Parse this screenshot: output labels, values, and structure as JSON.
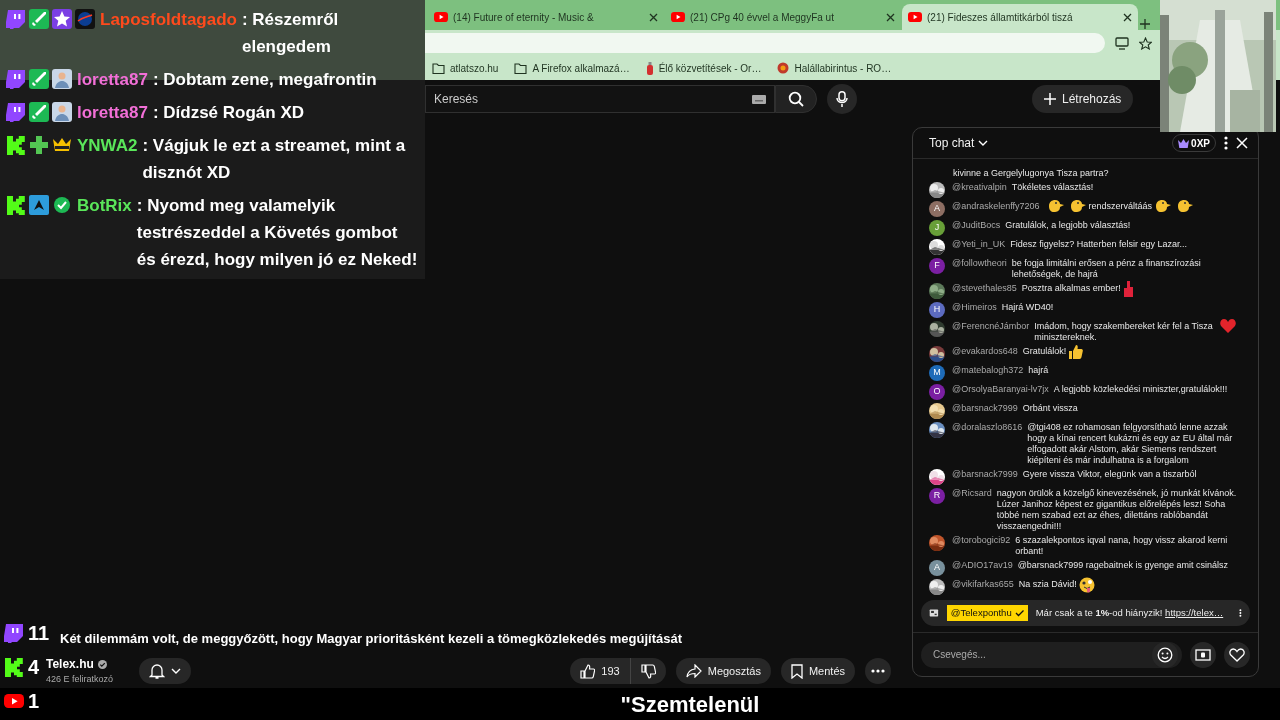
{
  "browser": {
    "tabs": [
      {
        "title": "(14) Future of eternity - Music &",
        "selected": false
      },
      {
        "title": "(21) CPg 40 évvel a MeggyFa ut",
        "selected": false
      },
      {
        "title": "(21) Fideszes államtitkárból tiszá",
        "selected": true
      }
    ],
    "bookmarks": [
      {
        "label": "atlatszo.hu",
        "kind": "folder"
      },
      {
        "label": "A Firefox alkalmazá…",
        "kind": "folder"
      },
      {
        "label": "Élő közvetítések - Or…",
        "kind": "flask"
      },
      {
        "label": "Halállabirintus - RO…",
        "kind": "round"
      }
    ]
  },
  "youtube": {
    "search": {
      "placeholder": "Keresés"
    },
    "create": "Létrehozás",
    "video": {
      "title": "Két dilemmám volt, de meggyőzött, hogy Magyar prioritásként kezeli a tömegközlekedés megújítását",
      "channel": {
        "name": "Telex.hu",
        "verified": true,
        "subscribers": "426 E feliratkozó"
      },
      "likes": "193",
      "share": "Megosztás",
      "save": "Mentés"
    },
    "chat": {
      "title": "Top chat",
      "xp": "0XP",
      "messages": [
        {
          "avatar": {
            "kind": "none"
          },
          "segments": [
            {
              "kind": "text",
              "text": "kivinne a Gergelylugonya Tisza partra?"
            }
          ]
        },
        {
          "avatar": {
            "kind": "picture"
          },
          "author": "@kreativalpin",
          "segments": [
            {
              "kind": "text",
              "text": "Tökéletes választás!"
            }
          ]
        },
        {
          "avatar": {
            "kind": "letter",
            "letter": "A",
            "color": "#8d6e63"
          },
          "author": "@andraskelenffy7206",
          "segments": [
            {
              "kind": "bird"
            },
            {
              "kind": "bird"
            },
            {
              "kind": "text",
              "text": "rendszerváltáás"
            },
            {
              "kind": "bird"
            },
            {
              "kind": "bird"
            }
          ]
        },
        {
          "avatar": {
            "kind": "letter",
            "letter": "J",
            "color": "#689f38"
          },
          "author": "@JuditBocs",
          "segments": [
            {
              "kind": "text",
              "text": "Gratulálok, a legjobb választás!"
            }
          ]
        },
        {
          "avatar": {
            "kind": "picture"
          },
          "author": "@Yeti_in_UK",
          "segments": [
            {
              "kind": "text",
              "text": "Fidesz figyelsz? Hatterben felsir egy Lazar..."
            }
          ]
        },
        {
          "avatar": {
            "kind": "letter",
            "letter": "F",
            "color": "#7b1fa2"
          },
          "author": "@followtheori",
          "segments": [
            {
              "kind": "text",
              "text": "be fogja limitálni erősen a pénz a finanszírozási lehetőségek, de hajrá"
            }
          ]
        },
        {
          "avatar": {
            "kind": "picture"
          },
          "author": "@stevethales85",
          "segments": [
            {
              "kind": "text",
              "text": "Posztra alkalmas ember!"
            },
            {
              "kind": "finger"
            }
          ]
        },
        {
          "avatar": {
            "kind": "letter",
            "letter": "H",
            "color": "#5c6bc0"
          },
          "author": "@Himeiros",
          "segments": [
            {
              "kind": "text",
              "text": "Hajrá WD40!"
            }
          ]
        },
        {
          "avatar": {
            "kind": "picture"
          },
          "author": "@FerencnéJámbor",
          "segments": [
            {
              "kind": "text",
              "text": "Imádom, hogy szakembereket kér fel a Tisza minisztereknek."
            },
            {
              "kind": "heart"
            }
          ]
        },
        {
          "avatar": {
            "kind": "picture"
          },
          "author": "@evakardos648",
          "segments": [
            {
              "kind": "text",
              "text": "Gratulálok!"
            },
            {
              "kind": "thumbs"
            }
          ]
        },
        {
          "avatar": {
            "kind": "letter",
            "letter": "M",
            "color": "#1e6bb8"
          },
          "author": "@matebalogh372",
          "segments": [
            {
              "kind": "text",
              "text": "hajrá"
            }
          ]
        },
        {
          "avatar": {
            "kind": "letter",
            "letter": "O",
            "color": "#7b1fa2"
          },
          "author": "@OrsolyaBaranyai-lv7jx",
          "segments": [
            {
              "kind": "text",
              "text": "A legjobb közlekedési miniszter,gratulálok!!!"
            }
          ]
        },
        {
          "avatar": {
            "kind": "picture"
          },
          "author": "@barsnack7999",
          "segments": [
            {
              "kind": "text",
              "text": "Orbánt vissza"
            }
          ]
        },
        {
          "avatar": {
            "kind": "picture"
          },
          "author": "@doralaszlo8616",
          "segments": [
            {
              "kind": "text",
              "text": "@tgi408 ez rohamosan felgyorsítható lenne azzak hogy a kínai rencert kukázni és egy az EU által már elfogadott akár Alstom, akár Siemens rendszert kiépíteni és már indulhatna is a forgalom"
            }
          ]
        },
        {
          "avatar": {
            "kind": "picture"
          },
          "author": "@barsnack7999",
          "segments": [
            {
              "kind": "text",
              "text": "Gyere vissza Viktor, elegünk van a tiszarból"
            }
          ]
        },
        {
          "avatar": {
            "kind": "letter",
            "letter": "R",
            "color": "#7b1fa2"
          },
          "author": "@Ricsard",
          "segments": [
            {
              "kind": "text",
              "text": "nagyon örülök a közelgő kinevezésének, jó munkát kívánok. Lúzer Janihoz képest ez gigantikus előrelépés lesz! Soha többé nem szabad ezt az éhes, dilettáns rablóbandát visszaengedni!!!"
            }
          ]
        },
        {
          "avatar": {
            "kind": "picture"
          },
          "author": "@torobogici92",
          "segments": [
            {
              "kind": "text",
              "text": "6 szazalekpontos iqval nana, hogy vissz akarod kerni orbant!"
            }
          ]
        },
        {
          "avatar": {
            "kind": "letter",
            "letter": "A",
            "color": "#78909c"
          },
          "author": "@ADIO17av19",
          "segments": [
            {
              "kind": "text",
              "text": "@barsnack7999 ragebaitnek is gyenge amit csinálsz"
            }
          ]
        },
        {
          "avatar": {
            "kind": "picture"
          },
          "author": "@vikifarkas655",
          "segments": [
            {
              "kind": "text",
              "text": "Na szia Dávid!"
            },
            {
              "kind": "silly"
            }
          ]
        }
      ],
      "pinned": {
        "author": "@Telexponthu",
        "verified": true,
        "text": "Már csak a te **1%**-od hiányzik!",
        "link": "https://telex…"
      },
      "input": {
        "placeholder": "Csevegés..."
      }
    }
  },
  "stream_overlay": {
    "messages": [
      {
        "kind": "twitch",
        "badges": [
          {
            "kind": "sword"
          },
          {
            "kind": "star"
          },
          {
            "kind": "globe"
          }
        ],
        "user": "Laposfoldtagado",
        "color": "#ff4a1c",
        "message": ": Részemről elengedem"
      },
      {
        "kind": "twitch",
        "badges": [
          {
            "kind": "sword"
          },
          {
            "kind": "figure"
          }
        ],
        "user": "loretta87",
        "color": "#f26fd7",
        "message": ": Dobtam zene, megafrontin"
      },
      {
        "kind": "twitch",
        "badges": [
          {
            "kind": "sword"
          },
          {
            "kind": "figure"
          }
        ],
        "user": "loretta87",
        "color": "#f26fd7",
        "message": ": Dídzsé Rogán XD"
      },
      {
        "kind": "kick",
        "badges": [
          {
            "kind": "plus"
          },
          {
            "kind": "crown"
          }
        ],
        "user": "YNWA2",
        "color": "#5ae65a",
        "message": ": Vágjuk le ezt a streamet, mint a disznót XD"
      },
      {
        "kind": "kick",
        "badges": [
          {
            "kind": "bot"
          },
          {
            "kind": "check"
          }
        ],
        "user": "BotRix",
        "color": "#5ae65a",
        "message": ": Nyomd meg valamelyik testrészeddel a Követés gombot és érezd, hogy milyen jó ez Neked!"
      }
    ],
    "counters": [
      {
        "kind": "twitch",
        "count": "11"
      },
      {
        "kind": "kick",
        "count": "4"
      },
      {
        "kind": "youtube",
        "count": "1"
      }
    ],
    "caption": "\"Szemtelenül"
  }
}
